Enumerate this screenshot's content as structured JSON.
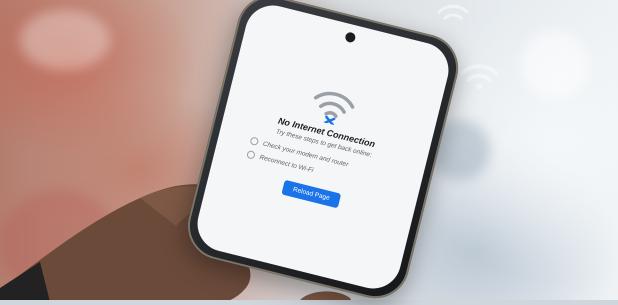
{
  "screen": {
    "title": "No Internet Connection",
    "subtitle": "Try these steps to get back online:",
    "steps": [
      "Check your modem and router",
      "Reconnect to Wi-Fi"
    ],
    "button_label": "Reload Page",
    "icon": "wifi-off-icon"
  },
  "floating_icons": [
    "wifi-add-icon",
    "wifi-icon",
    "wifi-icon"
  ],
  "colors": {
    "accent": "#1a73e8",
    "screen_bg": "#f4f6f8",
    "wifi_icon": "#9aa0a6",
    "error_mark": "#1a73e8"
  }
}
